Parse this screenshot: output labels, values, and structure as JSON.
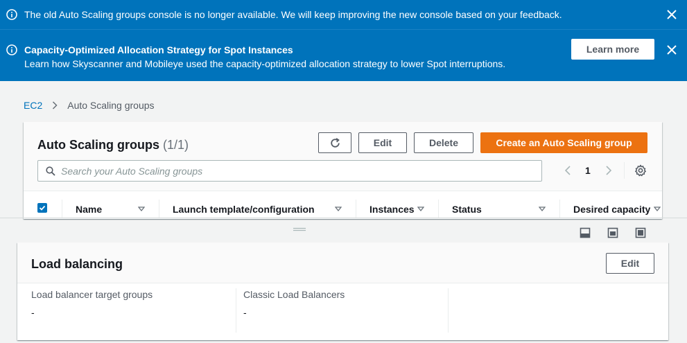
{
  "flash": [
    {
      "message": "The old Auto Scaling groups console is no longer available. We will keep improving the new console based on your feedback."
    },
    {
      "title": "Capacity-Optimized Allocation Strategy for Spot Instances",
      "message": "Learn how Skyscanner and Mobileye used the capacity-optimized allocation strategy to lower Spot interruptions.",
      "button": "Learn more"
    }
  ],
  "breadcrumb": {
    "root": "EC2",
    "current": "Auto Scaling groups"
  },
  "asg_panel": {
    "title": "Auto Scaling groups",
    "count": "(1/1)",
    "edit_label": "Edit",
    "delete_label": "Delete",
    "create_label": "Create an Auto Scaling group",
    "search_placeholder": "Search your Auto Scaling groups",
    "page": "1",
    "columns": [
      "Name",
      "Launch template/configuration",
      "Instances",
      "Status",
      "Desired capacity"
    ]
  },
  "lb_panel": {
    "title": "Load balancing",
    "edit_label": "Edit",
    "target_groups_label": "Load balancer target groups",
    "target_groups_value": "-",
    "classic_label": "Classic Load Balancers",
    "classic_value": "-"
  },
  "colors": {
    "flash_bg": "#0073bb",
    "primary": "#ec7211",
    "link": "#0073bb"
  }
}
